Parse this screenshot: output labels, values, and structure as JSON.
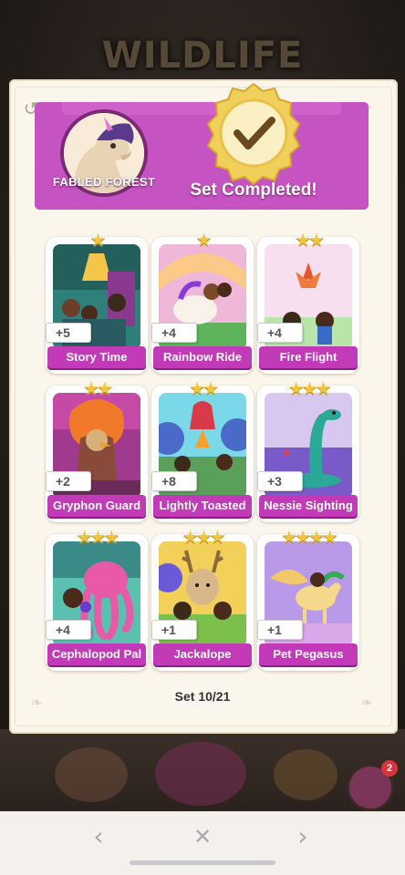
{
  "game": {
    "album_title": "WILDLIFE"
  },
  "header": {
    "set_name": "FABLED FOREST",
    "status_text": "Set Completed!"
  },
  "cards": [
    {
      "name": "Story Time",
      "stars": 1,
      "count": "+5"
    },
    {
      "name": "Rainbow Ride",
      "stars": 1,
      "count": "+4"
    },
    {
      "name": "Fire Flight",
      "stars": 2,
      "count": "+4"
    },
    {
      "name": "Gryphon Guard",
      "stars": 2,
      "count": "+2"
    },
    {
      "name": "Lightly Toasted",
      "stars": 2,
      "count": "+8"
    },
    {
      "name": "Nessie Sighting",
      "stars": 3,
      "count": "+3"
    },
    {
      "name": "Cephalopod Pal",
      "stars": 3,
      "count": "+4"
    },
    {
      "name": "Jackalope",
      "stars": 3,
      "count": "+1"
    },
    {
      "name": "Pet Pegasus",
      "stars": 4,
      "count": "+1"
    }
  ],
  "footer": {
    "set_counter": "Set 10/21"
  },
  "notification": {
    "badge_count": "2"
  },
  "navigation": {
    "prev_icon": "chevron-left-icon",
    "close_icon": "close-icon",
    "next_icon": "chevron-right-icon"
  },
  "colors": {
    "banner": "#c653c2",
    "label": "#c23ab8",
    "star": "#f2c53d",
    "seal": "#f0cf5a"
  }
}
